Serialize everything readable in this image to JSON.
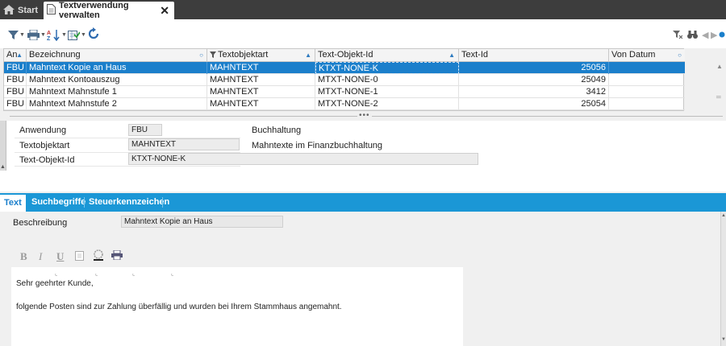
{
  "tabs": {
    "start": "Start",
    "active": "Textverwendung verwalten",
    "close": "✕"
  },
  "toolbar": {
    "icons": [
      "filter-icon",
      "print-icon",
      "sort-az-icon",
      "export-icon",
      "refresh-icon"
    ],
    "right_icons": [
      "filter-clear-icon",
      "binoculars-icon",
      "prev-icon",
      "next-icon",
      "status-dot-icon"
    ]
  },
  "grid": {
    "headers": [
      "An",
      "Bezeichnung",
      "Textobjektart",
      "Text-Objekt-Id",
      "Text-Id",
      "Von Datum"
    ],
    "rows": [
      [
        "FBU",
        "Mahntext Kopie an Haus",
        "MAHNTEXT",
        "KTXT-NONE-K",
        "25056",
        ""
      ],
      [
        "FBU",
        "Mahntext Kontoauszug",
        "MAHNTEXT",
        "MTXT-NONE-0",
        "25049",
        ""
      ],
      [
        "FBU",
        "Mahntext Mahnstufe 1",
        "MAHNTEXT",
        "MTXT-NONE-1",
        "3412",
        ""
      ],
      [
        "FBU",
        "Mahntext Mahnstufe 2",
        "MAHNTEXT",
        "MTXT-NONE-2",
        "25054",
        ""
      ]
    ],
    "selected_row": 0
  },
  "details": {
    "anwendung_label": "Anwendung",
    "anwendung_value": "FBU",
    "anwendung_desc": "Buchhaltung",
    "textobjektart_label": "Textobjektart",
    "textobjektart_value": "MAHNTEXT",
    "textobjektart_desc": "Mahntexte im Finanzbuchhaltung",
    "textobjektid_label": "Text-Objekt-Id",
    "textobjektid_value": "KTXT-NONE-K"
  },
  "subtabs": [
    "Text",
    "Suchbegriffe",
    "Steuerkennzeichen"
  ],
  "textsection": {
    "beschreibung_label": "Beschreibung",
    "beschreibung_value": "Mahntext Kopie an Haus",
    "editor_tools": [
      "B",
      "I",
      "U"
    ],
    "editor_lines": [
      "Sehr geehrter Kunde,",
      "folgende Posten sind zur Zahlung überfällig und wurden bei Ihrem Stammhaus angemahnt."
    ]
  },
  "colors": {
    "selection": "#1b7fcb",
    "subtab_bar": "#1b97d6",
    "tabbar": "#3d3d3d"
  }
}
